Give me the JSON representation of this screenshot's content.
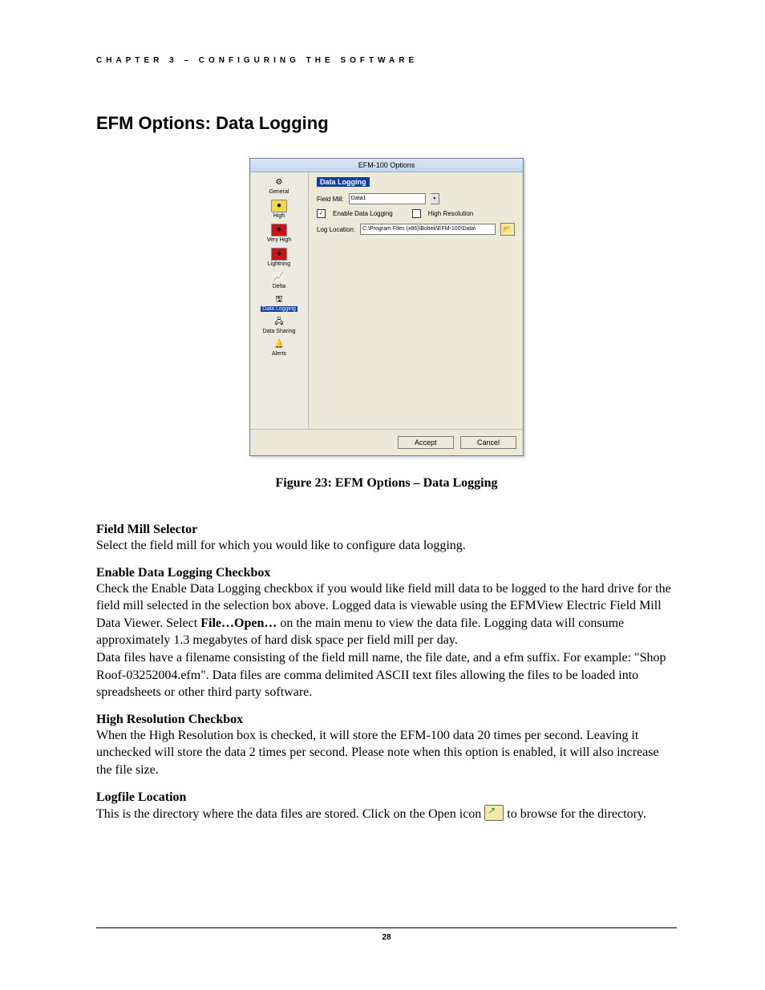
{
  "header": {
    "chapter": "CHAPTER 3 – CONFIGURING THE SOFTWARE"
  },
  "section_title": "EFM Options: Data Logging",
  "dialog": {
    "title": "EFM-100 Options",
    "sidebar": {
      "items": [
        {
          "label": "General"
        },
        {
          "label": "High"
        },
        {
          "label": "Very High"
        },
        {
          "label": "Lightning"
        },
        {
          "label": "Delta"
        },
        {
          "label": "Data Logging",
          "selected": true
        },
        {
          "label": "Data Sharing"
        },
        {
          "label": "Alerts"
        }
      ]
    },
    "panel": {
      "title": "Data Logging",
      "field_mill_label": "Field Mill:",
      "field_mill_value": "Data1",
      "enable_logging_label": "Enable Data Logging",
      "enable_logging_checked": true,
      "high_res_label": "High Resolution",
      "high_res_checked": false,
      "log_location_label": "Log Location:",
      "log_location_value": "C:\\Program Files (x86)\\Boltek\\EFM-100\\Data\\"
    },
    "footer": {
      "accept": "Accept",
      "cancel": "Cancel"
    }
  },
  "figure_caption": "Figure 23:  EFM Options – Data Logging",
  "body": {
    "h1": "Field Mill Selector",
    "p1": "Select the field mill for which you would like to configure data logging.",
    "h2": "Enable Data Logging Checkbox",
    "p2a": "Check the Enable Data Logging checkbox if you would like field mill data to be logged to the hard drive for the field mill selected in the selection box above.  Logged data is viewable using the EFMView Electric Field Mill Data Viewer.  Select ",
    "p2b_bold": "File…Open…",
    "p2c": " on the main menu to view the data file.  Logging data will consume approximately 1.3 megabytes of hard disk space per field mill per day.",
    "p2d": "Data files have a filename consisting of the field mill name, the file date, and a efm suffix.  For example: \"Shop Roof-03252004.efm\".  Data files are comma delimited ASCII text files allowing the files to be loaded into spreadsheets or other third party software.",
    "h3": "High Resolution Checkbox",
    "p3": "When the High Resolution box is checked, it will store the EFM-100 data 20 times per second. Leaving it unchecked will store the data 2 times per second. Please note when this option is enabled, it will also increase the file size.",
    "h4": "Logfile Location",
    "p4a": "This is the directory where the data files are stored.  Click on the Open icon ",
    "p4b": " to browse for the directory."
  },
  "page_number": "28"
}
